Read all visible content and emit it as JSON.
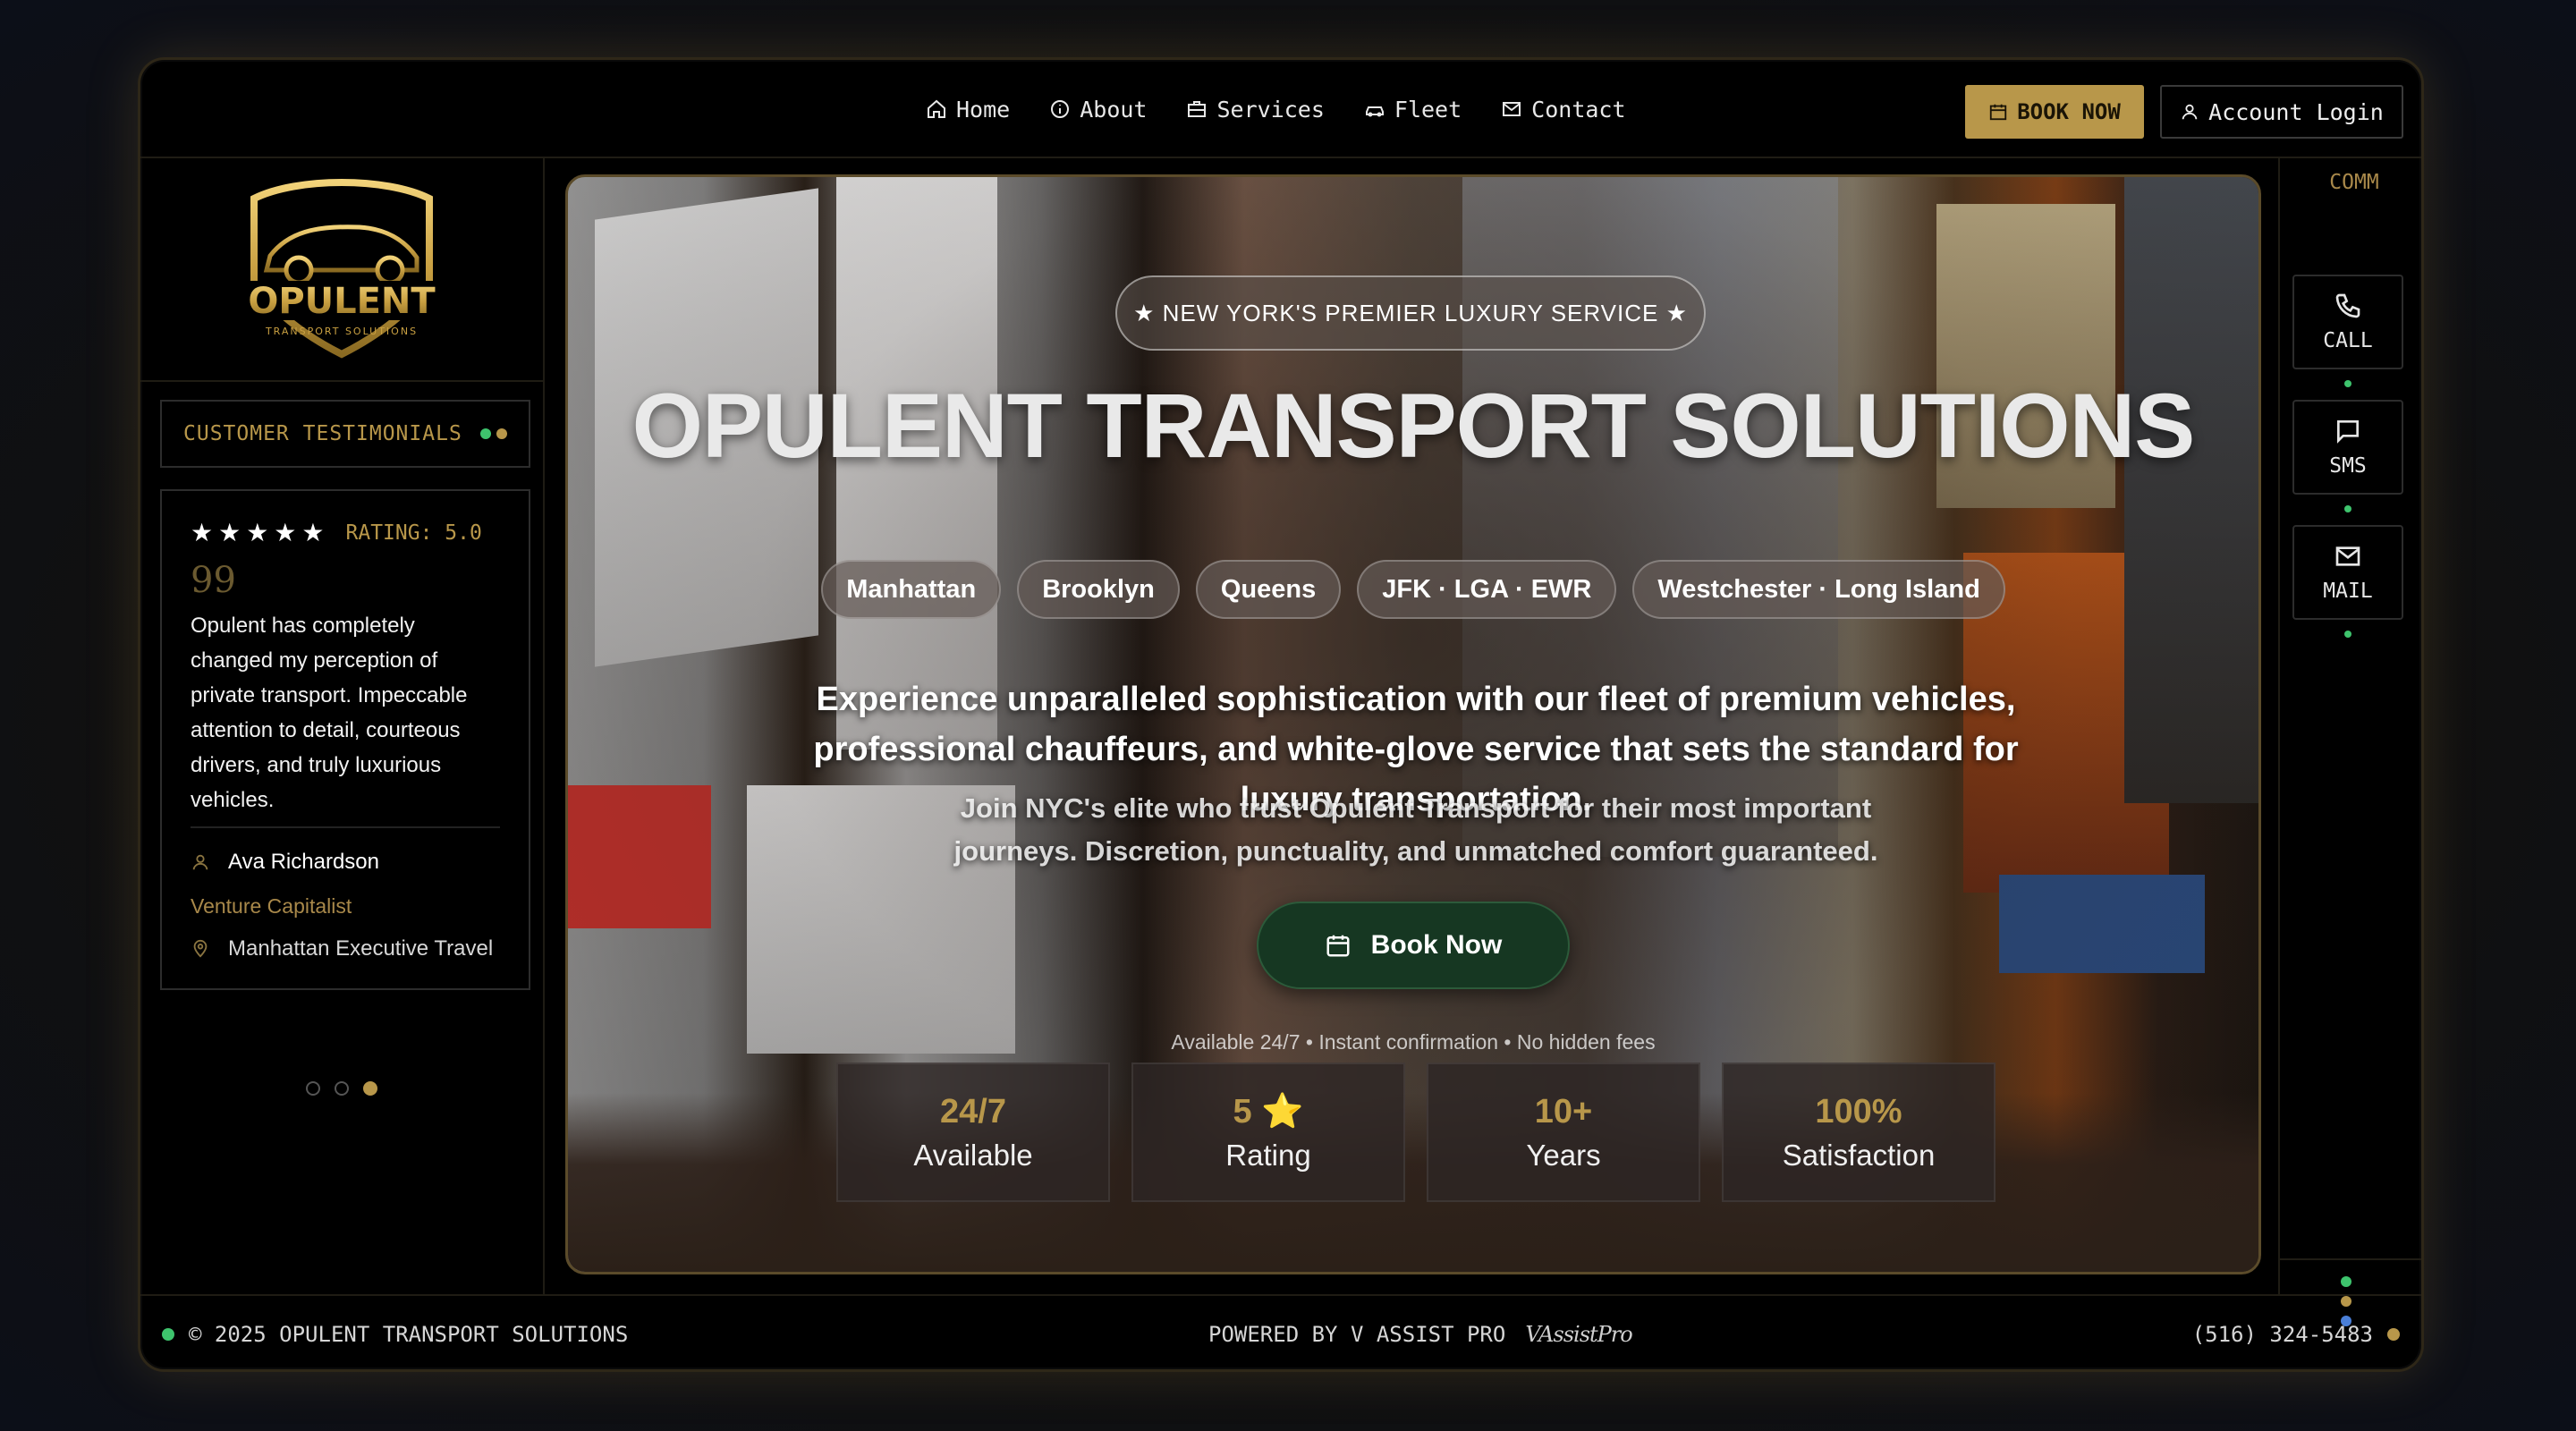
{
  "nav": {
    "items": [
      {
        "label": "Home",
        "icon": "home-icon"
      },
      {
        "label": "About",
        "icon": "info-icon"
      },
      {
        "label": "Services",
        "icon": "briefcase-icon"
      },
      {
        "label": "Fleet",
        "icon": "car-icon"
      },
      {
        "label": "Contact",
        "icon": "mail-icon"
      }
    ],
    "book_label": "BOOK NOW",
    "login_label": "Account Login"
  },
  "logo": {
    "name": "OPULENT",
    "tagline": "TRANSPORT SOLUTIONS"
  },
  "testimonials": {
    "heading": "CUSTOMER TESTIMONIALS",
    "stars": "★★★★★",
    "rating": "RATING: 5.0",
    "quote_mark": "99",
    "text": "Opulent has completely changed my perception of private transport. Impeccable attention to detail, courteous drivers, and truly luxurious vehicles.",
    "author": "Ava Richardson",
    "role": "Venture Capitalist",
    "context": "Manhattan Executive Travel",
    "active_slide": 3,
    "total_slides": 3
  },
  "hero": {
    "badge": "★ NEW YORK'S PREMIER LUXURY SERVICE ★",
    "title": "OPULENT TRANSPORT SOLUTIONS",
    "areas": [
      "Manhattan",
      "Brooklyn",
      "Queens",
      "JFK · LGA · EWR",
      "Westchester · Long Island"
    ],
    "lead": "Experience unparalleled sophistication with our fleet of premium vehicles, professional chauffeurs, and white-glove service that sets the standard for luxury transportation.",
    "sub": "Join NYC's elite who trust Opulent Transport for their most important journeys. Discretion, punctuality, and unmatched comfort guaranteed.",
    "cta": "Book Now",
    "availability": "Available 24/7 • Instant confirmation • No hidden fees",
    "stats": [
      {
        "value": "24/7",
        "label": "Available"
      },
      {
        "value": "5 ⭐",
        "label": "Rating"
      },
      {
        "value": "10+",
        "label": "Years"
      },
      {
        "value": "100%",
        "label": "Satisfaction"
      }
    ]
  },
  "comm": {
    "label": "COMM",
    "buttons": [
      {
        "label": "CALL",
        "icon": "phone-icon"
      },
      {
        "label": "SMS",
        "icon": "chat-icon"
      },
      {
        "label": "MAIL",
        "icon": "mail-icon"
      }
    ]
  },
  "footer": {
    "copyright": "© 2025 OPULENT TRANSPORT SOLUTIONS",
    "powered": "POWERED BY V ASSIST PRO",
    "powered_logo": "VAssistPro",
    "phone": "(516) 324-5483"
  },
  "colors": {
    "accent_gold": "#b8974a",
    "status_green": "#3ec46d",
    "status_blue": "#4a7fd8",
    "cta_green": "#163722"
  }
}
